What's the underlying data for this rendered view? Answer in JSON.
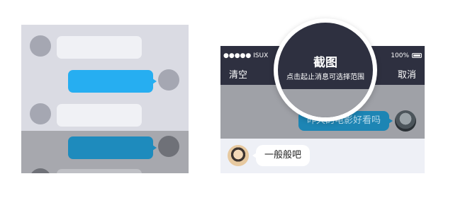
{
  "illustration": {
    "rows": [
      "incoming",
      "outgoing",
      "incoming",
      "outgoing-dimmed",
      "incoming-dimmed"
    ]
  },
  "phone": {
    "status_bar": {
      "carrier": "●●●●● ISUX",
      "wifi_icon": "wifi-icon",
      "battery": "100%"
    },
    "nav": {
      "clear_label": "清空",
      "cancel_label": "取消"
    },
    "messages": [
      {
        "direction": "outgoing",
        "text": "昨天的电影好看吗",
        "selected": true
      },
      {
        "direction": "incoming",
        "text": "一般般吧",
        "selected": false
      }
    ]
  },
  "tooltip": {
    "title": "截图",
    "subtitle": "点击起止消息可选择范围"
  },
  "colors": {
    "nav_bg": "#2e3040",
    "bubble_blue": "#26aef1",
    "selection_overlay": "#9fa1a7"
  }
}
